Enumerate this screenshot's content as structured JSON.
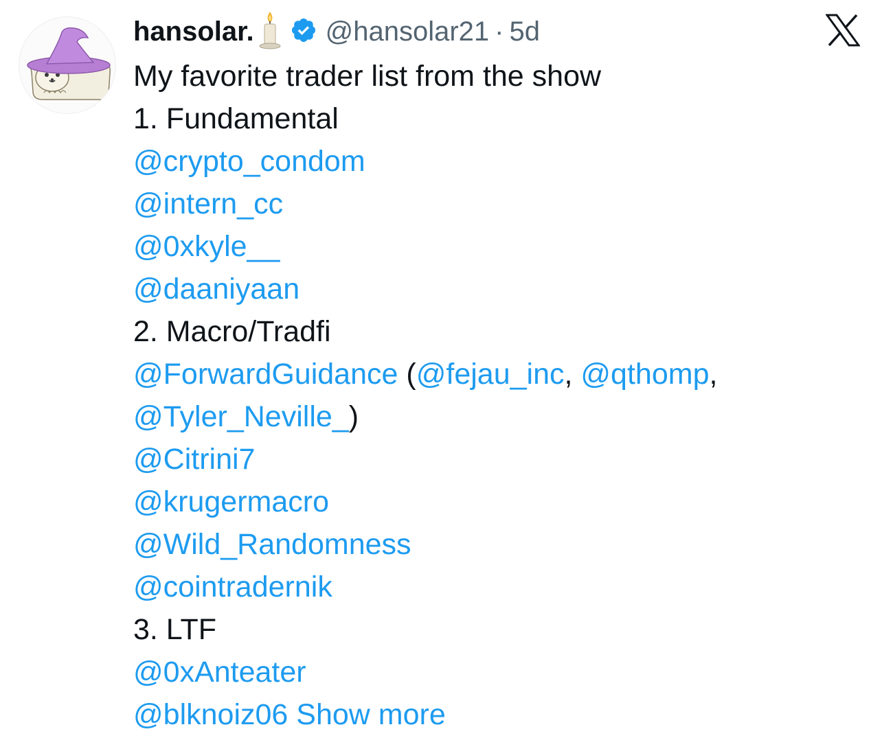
{
  "author": {
    "display_name": "hansolar.",
    "emoji_icon": "candle-emoji",
    "verified_icon": "verified-badge-icon",
    "handle": "@hansolar21",
    "separator": "·",
    "time": "5d"
  },
  "brand": {
    "logo_icon": "x-logo-icon"
  },
  "tweet": {
    "intro": "My favorite trader list from the show",
    "section1": "1. Fundamental",
    "m_crypto_condom": "@crypto_condom",
    "m_intern_cc": "@intern_cc",
    "m_0xkyle": "@0xkyle__",
    "m_daaniyaan": "@daaniyaan",
    "section2": "2. Macro/Tradfi",
    "m_forwardguidance": "@ForwardGuidance",
    "paren_open": " (",
    "m_fejau_inc": "@fejau_inc",
    "comma1": ", ",
    "m_qthomp": "@qthomp",
    "comma2": ",",
    "m_tyler_neville": "@Tyler_Neville_",
    "paren_close": ")",
    "m_citrini7": "@Citrini7",
    "m_krugermacro": "@krugermacro",
    "m_wild_randomness": "@Wild_Randomness",
    "m_cointradernik": "@cointradernik",
    "section3": "3. LTF",
    "m_0xanteater": "@0xAnteater",
    "m_blknoiz06": "@blknoiz06",
    "show_more": "Show more"
  },
  "colors": {
    "link": "#1d9bf0",
    "text": "#0f1419",
    "secondary": "#536471",
    "verified": "#1d9bf0"
  }
}
